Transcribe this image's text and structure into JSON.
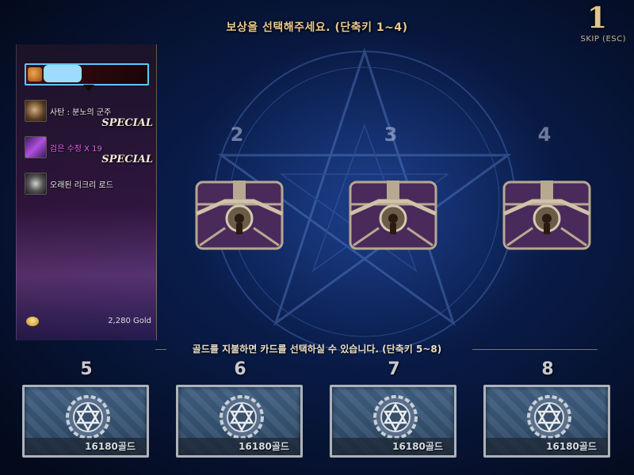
{
  "header": {
    "instruction": "보상을 선택해주세요. (단축키 1~4)",
    "timer": "1",
    "skip_label": "SKIP (ESC)"
  },
  "reward_panel": {
    "items": [
      {
        "name": "사탄 : 분노의 군주",
        "badge": "SPECIAL",
        "icon": "demon-portrait-icon"
      },
      {
        "name": "검은 수정 X 19",
        "badge": "SPECIAL",
        "icon": "black-crystal-icon"
      },
      {
        "name": "오래된 리크리 로드",
        "badge": "",
        "icon": "rod-icon"
      }
    ],
    "gold_amount": "2,280 Gold"
  },
  "chests": [
    {
      "number": "2"
    },
    {
      "number": "3"
    },
    {
      "number": "4"
    }
  ],
  "gold_instruction": "골드를 지불하면 카드를 선택하실 수 있습니다. (단축키 5~8)",
  "gold_cards": [
    {
      "number": "5",
      "price": "16180골드"
    },
    {
      "number": "6",
      "price": "16180골드"
    },
    {
      "number": "7",
      "price": "16180골드"
    },
    {
      "number": "8",
      "price": "16180골드"
    }
  ],
  "colors": {
    "header_text": "#e9c98e",
    "player_border": "#5cc8ff",
    "card_frame": "#aeb3ba"
  }
}
